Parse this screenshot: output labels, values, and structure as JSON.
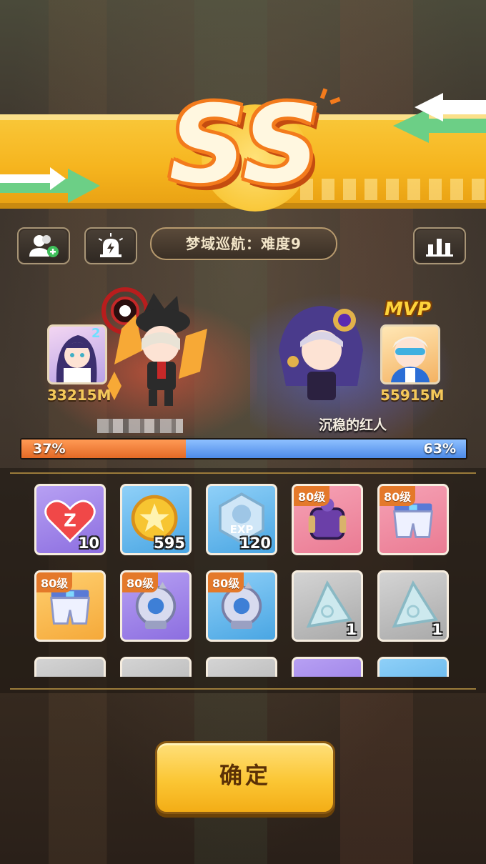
{
  "result": {
    "grade": "SS",
    "stage_title": "梦域巡航：难度9"
  },
  "toolbar": {
    "add_friend_icon": "add-friend-icon",
    "report_icon": "alarm-light-icon",
    "stats_icon": "bar-chart-icon"
  },
  "players": {
    "left": {
      "score": "33215M",
      "level_badge": "2"
    },
    "right": {
      "score": "55915M",
      "name": "沉稳的红人",
      "mvp": "MVP"
    }
  },
  "damage_share": {
    "left_label": "37%",
    "right_label": "63%",
    "left_fraction": 0.37,
    "right_fraction": 0.63
  },
  "rewards": [
    {
      "icon": "heart-z-icon",
      "qty": "10",
      "level": "",
      "bg": "purple"
    },
    {
      "icon": "gold-coin-icon",
      "qty": "595",
      "level": "",
      "bg": "blue"
    },
    {
      "icon": "exp-badge-icon",
      "qty": "120",
      "level": "",
      "bg": "blue"
    },
    {
      "icon": "bracer-icon",
      "qty": "",
      "level": "80级",
      "bg": "pink"
    },
    {
      "icon": "shorts-icon",
      "qty": "",
      "level": "80级",
      "bg": "pink"
    },
    {
      "icon": "shorts-icon",
      "qty": "",
      "level": "80级",
      "bg": "orange"
    },
    {
      "icon": "gauntlet-icon",
      "qty": "",
      "level": "80级",
      "bg": "purple"
    },
    {
      "icon": "gauntlet-icon",
      "qty": "",
      "level": "80级",
      "bg": "blue"
    },
    {
      "icon": "crystal-shard-icon",
      "qty": "1",
      "level": "",
      "bg": "gray"
    },
    {
      "icon": "crystal-shard-icon",
      "qty": "1",
      "level": "",
      "bg": "gray"
    }
  ],
  "confirm_label": "确定",
  "colors": {
    "banner": "#f6b51f",
    "grade_outline": "#f37b1c",
    "left_bar": "#e36a26",
    "right_bar": "#4d8be8",
    "score": "#f4c85a",
    "confirm": "#fbc634"
  }
}
